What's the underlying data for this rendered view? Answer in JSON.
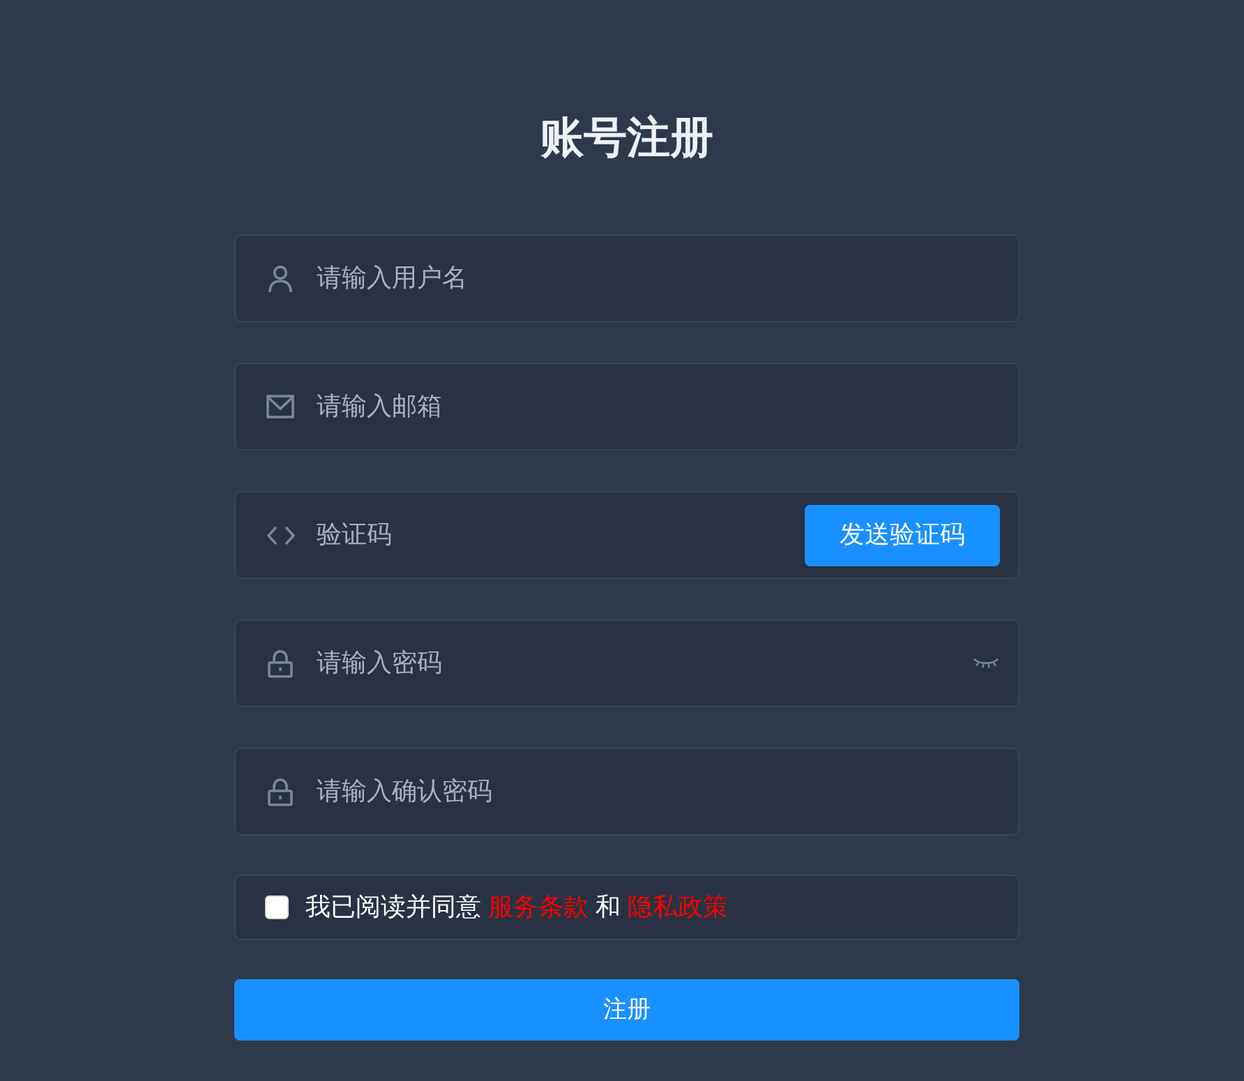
{
  "title": "账号注册",
  "fields": [
    {
      "kind": "username",
      "placeholder": "请输入用户名"
    },
    {
      "kind": "email",
      "placeholder": "请输入邮箱"
    },
    {
      "kind": "code",
      "placeholder": "验证码",
      "button": "发送验证码"
    },
    {
      "kind": "password",
      "placeholder": "请输入密码"
    },
    {
      "kind": "confirm_password",
      "placeholder": "请输入确认密码"
    }
  ],
  "agreement": {
    "checked": false,
    "text": "我已阅读并同意",
    "terms_link": "服务条款",
    "conjunction": "和",
    "privacy_link": "隐私政策"
  },
  "submit_button": "注册"
}
